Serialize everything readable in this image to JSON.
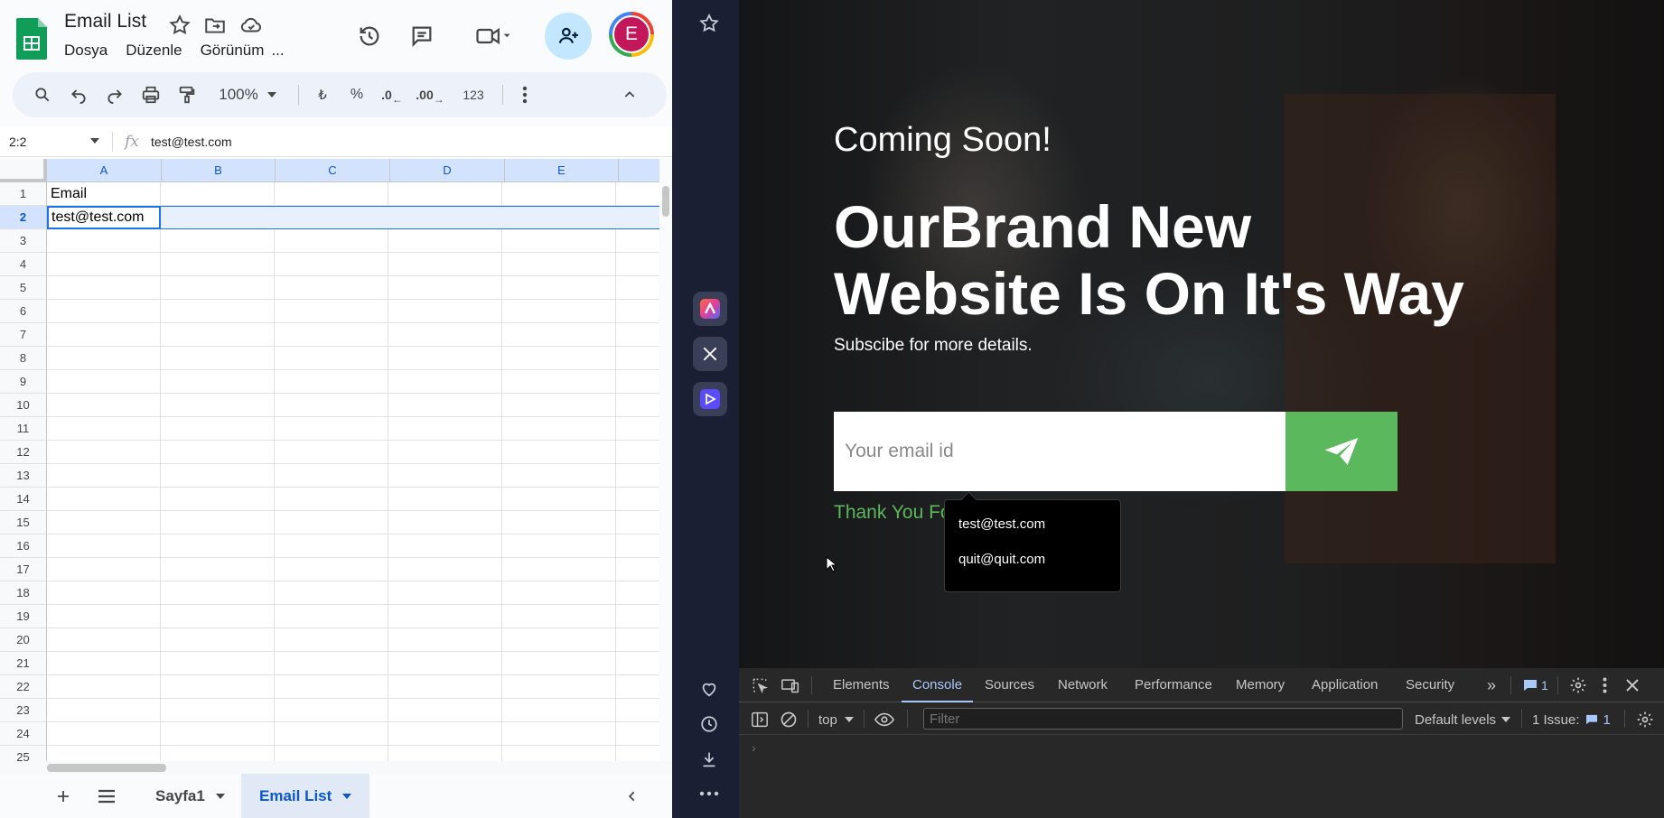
{
  "sheets": {
    "title": "Email List",
    "menu": [
      "Dosya",
      "Düzenle",
      "Görünüm",
      "..."
    ],
    "avatar_initial": "E",
    "toolbar": {
      "zoom": "100%",
      "currency": "₺",
      "percent": "%",
      "decrease_decimal": ".0",
      "increase_decimal": ".00",
      "number_format": "123"
    },
    "name_box": "2:2",
    "fx": "fx",
    "formula_value": "test@test.com",
    "columns": [
      "A",
      "B",
      "C",
      "D",
      "E"
    ],
    "rows": [
      "1",
      "2",
      "3",
      "4",
      "5",
      "6",
      "7",
      "8",
      "9",
      "10",
      "11",
      "12",
      "13",
      "14",
      "15",
      "16",
      "17",
      "18",
      "19",
      "20",
      "21",
      "22",
      "23",
      "24",
      "25"
    ],
    "cells": {
      "A1": "Email",
      "A2": "test@test.com"
    },
    "tabs": [
      "Sayfa1",
      "Email List"
    ],
    "active_tab": "Email List"
  },
  "webpage": {
    "coming_soon": "Coming Soon!",
    "headline": "OurBrand New Website Is On It's Way",
    "subscribe": "Subscibe for more details.",
    "email_placeholder": "Your email id",
    "thanks": "Thank You Fo",
    "autocomplete": [
      "test@test.com",
      "quit@quit.com"
    ],
    "accent_color": "#5cb85c"
  },
  "devtools": {
    "tabs": [
      "Elements",
      "Console",
      "Sources",
      "Network",
      "Performance",
      "Memory",
      "Application",
      "Security"
    ],
    "active_tab": "Console",
    "messages_count": "1",
    "context": "top",
    "filter_placeholder": "Filter",
    "levels": "Default levels",
    "issues_label": "1 Issue:",
    "issues_count": "1",
    "prompt": "›"
  }
}
